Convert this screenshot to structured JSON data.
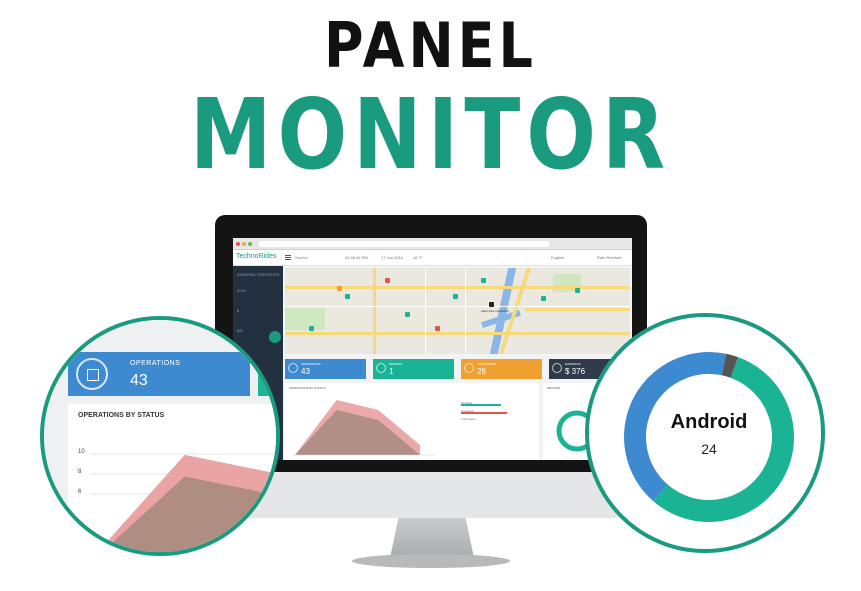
{
  "hero": {
    "line1": "PANEL",
    "line2": "MONITOR"
  },
  "colors": {
    "accent": "#1a9b80",
    "blue": "#3e8ad0",
    "teal": "#1ab394",
    "orange": "#f0a030",
    "dark": "#2f3b48",
    "area_fill": "#e89a9a"
  },
  "screen": {
    "brand": "TechnoRides",
    "search": "Search",
    "header_meta": [
      "04:26:44 PM",
      "17 Jun 2016",
      "16 °F"
    ],
    "language": "English",
    "user": "Ruth Reinhart",
    "sidebar": [
      "GENERAL STATISTICS",
      "2016",
      "6",
      "6/8"
    ],
    "tiles": [
      {
        "label": "OPERATIONS",
        "value": "43",
        "icon": "chart-icon"
      },
      {
        "label": "DRIVERS",
        "value": "1",
        "icon": "car-icon"
      },
      {
        "label": "CUSTOMERS",
        "value": "28",
        "icon": "user-icon"
      },
      {
        "label": "EARNINGS",
        "value": "$ 376",
        "icon": "dollar-icon"
      }
    ],
    "panels": {
      "ops_status": "OPERATIONS BY STATUS",
      "devices": "DEVICES"
    },
    "legend": [
      "Finished",
      "Canceled",
      "In Process"
    ],
    "map_marker": "Saint Paul Cathedral"
  },
  "zoom_left": {
    "tile_label": "OPERATIONS",
    "tile_value": "43",
    "card_title": "OPERATIONS BY STATUS",
    "ticks": [
      "10",
      "8",
      "6"
    ]
  },
  "zoom_right": {
    "label": "Android",
    "value": "24"
  },
  "chart_data": {
    "type": "area",
    "title": "OPERATIONS BY STATUS",
    "ylim": [
      0,
      12
    ],
    "series": [
      {
        "values": [
          0,
          11,
          9,
          2
        ],
        "color": "#e89a9a"
      },
      {
        "values": [
          0,
          9,
          7,
          0
        ],
        "color": "#a88b80"
      }
    ],
    "donut": [
      {
        "name": "Android",
        "value": 24,
        "color": "#1ab394"
      },
      {
        "value": 18,
        "color": "#3e8ad0"
      },
      {
        "value": 1,
        "color": "#555555"
      }
    ]
  }
}
